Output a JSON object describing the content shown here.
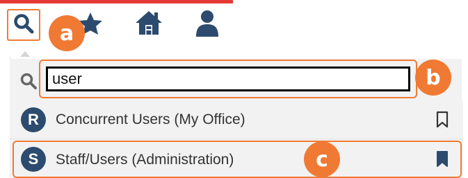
{
  "toolbar": {
    "search_icon": "search-icon",
    "favorites_icon": "star-icon",
    "home_icon": "home-icon",
    "profile_icon": "user-icon"
  },
  "annotations": {
    "a": "a",
    "b": "b",
    "c": "c"
  },
  "search": {
    "value": "user",
    "icon": "search-icon"
  },
  "results": [
    {
      "badge": "R",
      "label": "Concurrent Users (My Office)",
      "bookmarked": false
    },
    {
      "badge": "S",
      "label": "Staff/Users (Administration)",
      "bookmarked": true
    }
  ],
  "colors": {
    "accent": "#f07a33",
    "badge": "#2c4b6e",
    "toolbar_icon": "#2c4b6e",
    "top_strip": "#e53935"
  }
}
